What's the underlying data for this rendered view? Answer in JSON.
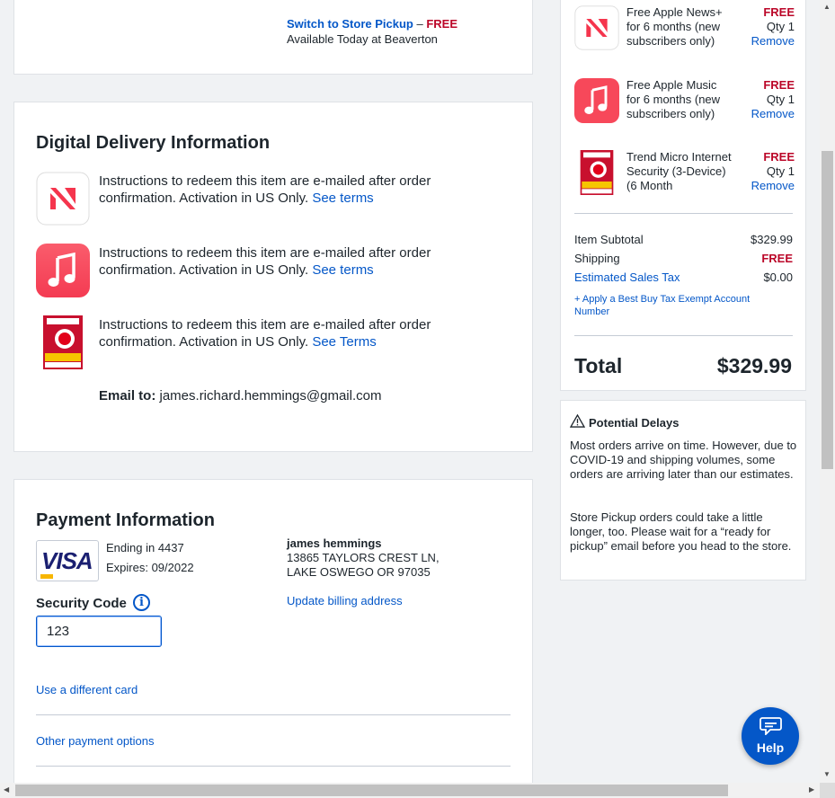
{
  "pickup": {
    "switch_label": "Switch to Store Pickup",
    "dash": " – ",
    "free": "FREE",
    "availability": "Available Today at Beaverton"
  },
  "digital": {
    "title": "Digital Delivery Information",
    "items": [
      {
        "text": "Instructions to redeem this item are e-mailed after order confirmation. Activation in US Only. ",
        "link": "See terms",
        "icon": "apple-news-icon"
      },
      {
        "text": "Instructions to redeem this item are e-mailed after order confirmation. Activation in US Only. ",
        "link": "See terms",
        "icon": "apple-music-icon"
      },
      {
        "text": "Instructions to redeem this item are e-mailed after order confirmation. Activation in US Only. ",
        "link": "See Terms",
        "icon": "trend-micro-box-icon"
      }
    ],
    "email_label": "Email to:",
    "email": " james.richard.hemmings@gmail.com"
  },
  "payment": {
    "title": "Payment Information",
    "card_brand": "VISA",
    "ending": "Ending in 4437",
    "expires": "Expires: 09/2022",
    "billing_name": "james hemmings",
    "billing_street": "13865 TAYLORS CREST LN,",
    "billing_city": "LAKE OSWEGO OR 97035",
    "update_billing": "Update billing address",
    "security_label": "Security Code",
    "security_value": "123",
    "use_different_card": "Use a different card",
    "other_options": "Other payment options"
  },
  "summary": {
    "items": [
      {
        "name": "Free Apple News+ for 6 months (new subscribers only)",
        "price": "FREE",
        "qty": "Qty 1",
        "remove": "Remove",
        "icon": "apple-news-icon"
      },
      {
        "name": "Free Apple Music for 6 months (new subscribers only)",
        "price": "FREE",
        "qty": "Qty 1",
        "remove": "Remove",
        "icon": "apple-music-icon"
      },
      {
        "name": "Trend Micro Internet Security (3-Device) (6 Month",
        "price": "FREE",
        "qty": "Qty 1",
        "remove": "Remove",
        "icon": "trend-micro-box-icon"
      }
    ],
    "subtotal_label": "Item Subtotal",
    "subtotal_value": "$329.99",
    "shipping_label": "Shipping",
    "shipping_value": "FREE",
    "tax_label": "Estimated Sales Tax",
    "tax_value": "$0.00",
    "exempt_link": "+ Apply a Best Buy Tax Exempt Account Number",
    "total_label": "Total",
    "total_value": "$329.99"
  },
  "delays": {
    "title": "Potential Delays",
    "p1": "Most orders arrive on time. However, due to COVID-19 and shipping volumes, some orders are arriving later than our estimates.",
    "p2": "Store Pickup orders could take a little longer, too. Please wait for a “ready for pickup” email before you head to the store."
  },
  "help": {
    "label": "Help"
  },
  "colors": {
    "link": "#0457c8",
    "free": "#bb0628",
    "news_red": "#f5354d",
    "music_red": "#fa4d5f"
  }
}
